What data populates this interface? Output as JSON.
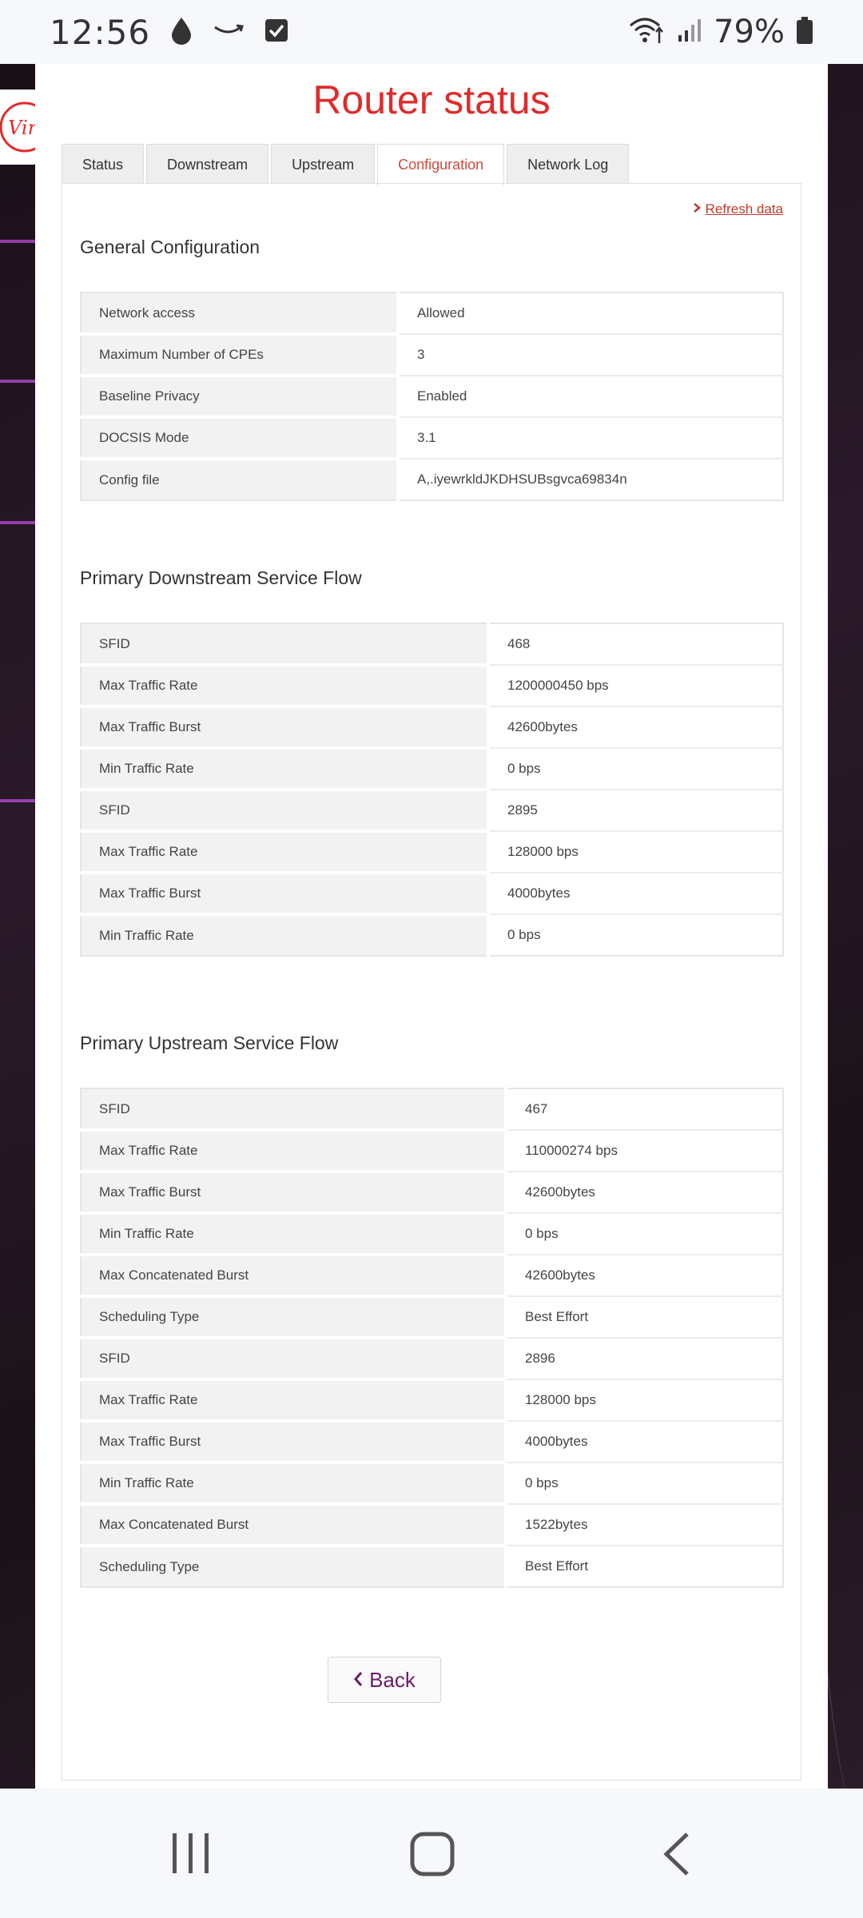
{
  "status_bar": {
    "time": "12:56",
    "battery_pct": "79%"
  },
  "page": {
    "title": "Router status",
    "tabs": [
      {
        "label": "Status",
        "active": false
      },
      {
        "label": "Downstream",
        "active": false
      },
      {
        "label": "Upstream",
        "active": false
      },
      {
        "label": "Configuration",
        "active": true
      },
      {
        "label": "Network Log",
        "active": false
      }
    ],
    "refresh_label": "Refresh data",
    "back_label": "Back"
  },
  "general": {
    "title": "General Configuration",
    "rows": [
      {
        "key": "Network access",
        "value": "Allowed"
      },
      {
        "key": "Maximum Number of CPEs",
        "value": "3"
      },
      {
        "key": "Baseline Privacy",
        "value": "Enabled"
      },
      {
        "key": "DOCSIS Mode",
        "value": "3.1"
      },
      {
        "key": "Config file",
        "value": "A,.iyewrkldJKDHSUBsgvca69834n"
      }
    ]
  },
  "downstream": {
    "title": "Primary Downstream Service Flow",
    "rows": [
      {
        "key": "SFID",
        "value": "468"
      },
      {
        "key": "Max Traffic Rate",
        "value": "1200000450 bps"
      },
      {
        "key": "Max Traffic Burst",
        "value": "42600bytes"
      },
      {
        "key": "Min Traffic Rate",
        "value": "0 bps"
      },
      {
        "key": "SFID",
        "value": "2895"
      },
      {
        "key": "Max Traffic Rate",
        "value": "128000 bps"
      },
      {
        "key": "Max Traffic Burst",
        "value": "4000bytes"
      },
      {
        "key": "Min Traffic Rate",
        "value": "0 bps"
      }
    ]
  },
  "upstream": {
    "title": "Primary Upstream Service Flow",
    "rows": [
      {
        "key": "SFID",
        "value": "467"
      },
      {
        "key": "Max Traffic Rate",
        "value": "110000274 bps"
      },
      {
        "key": "Max Traffic Burst",
        "value": "42600bytes"
      },
      {
        "key": "Min Traffic Rate",
        "value": "0 bps"
      },
      {
        "key": "Max Concatenated Burst",
        "value": "42600bytes"
      },
      {
        "key": "Scheduling Type",
        "value": "Best Effort"
      },
      {
        "key": "SFID",
        "value": "2896"
      },
      {
        "key": "Max Traffic Rate",
        "value": "128000 bps"
      },
      {
        "key": "Max Traffic Burst",
        "value": "4000bytes"
      },
      {
        "key": "Min Traffic Rate",
        "value": "0 bps"
      },
      {
        "key": "Max Concatenated Burst",
        "value": "1522bytes"
      },
      {
        "key": "Scheduling Type",
        "value": "Best Effort"
      }
    ]
  },
  "colors": {
    "brand_red": "#e02b2b",
    "tab_active": "#d04a3a",
    "back_text": "#6a1b6a"
  },
  "icons": [
    "water-drop-icon",
    "amazon-smile-icon",
    "checkbox-icon",
    "wifi-icon",
    "signal-icon",
    "battery-icon",
    "virgin-logo-icon",
    "chevron-right-icon",
    "chevron-left-icon",
    "recents-icon",
    "home-icon",
    "back-nav-icon"
  ]
}
